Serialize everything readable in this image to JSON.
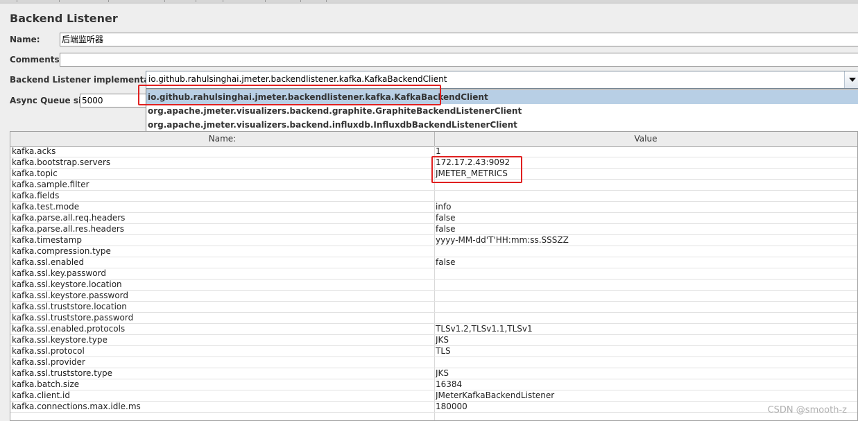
{
  "panel": {
    "title": "Backend Listener"
  },
  "form": {
    "name_label": "Name:",
    "name_value": "后端监听器",
    "comments_label": "Comments:",
    "comments_value": "",
    "impl_label": "Backend Listener implementation",
    "impl_selected": "io.github.rahulsinghai.jmeter.backendlistener.kafka.KafkaBackendClient",
    "queue_label": "Async Queue size",
    "queue_value": "5000"
  },
  "dropdown": {
    "arrow_icon": "chevron-down-icon",
    "options": [
      "io.github.rahulsinghai.jmeter.backendlistener.kafka.KafkaBackendClient",
      "org.apache.jmeter.visualizers.backend.graphite.GraphiteBackendListenerClient",
      "org.apache.jmeter.visualizers.backend.influxdb.InfluxdbBackendListenerClient"
    ],
    "selected_index": 0
  },
  "table": {
    "headers": {
      "name": "Name:",
      "value": "Value"
    },
    "rows": [
      {
        "name": "kafka.acks",
        "value": "1"
      },
      {
        "name": "kafka.bootstrap.servers",
        "value": "172.17.2.43:9092"
      },
      {
        "name": "kafka.topic",
        "value": "JMETER_METRICS"
      },
      {
        "name": "kafka.sample.filter",
        "value": ""
      },
      {
        "name": "kafka.fields",
        "value": ""
      },
      {
        "name": "kafka.test.mode",
        "value": "info"
      },
      {
        "name": "kafka.parse.all.req.headers",
        "value": "false"
      },
      {
        "name": "kafka.parse.all.res.headers",
        "value": "false"
      },
      {
        "name": "kafka.timestamp",
        "value": "yyyy-MM-dd'T'HH:mm:ss.SSSZZ"
      },
      {
        "name": "kafka.compression.type",
        "value": ""
      },
      {
        "name": "kafka.ssl.enabled",
        "value": "false"
      },
      {
        "name": "kafka.ssl.key.password",
        "value": ""
      },
      {
        "name": "kafka.ssl.keystore.location",
        "value": ""
      },
      {
        "name": "kafka.ssl.keystore.password",
        "value": ""
      },
      {
        "name": "kafka.ssl.truststore.location",
        "value": ""
      },
      {
        "name": "kafka.ssl.truststore.password",
        "value": ""
      },
      {
        "name": "kafka.ssl.enabled.protocols",
        "value": "TLSv1.2,TLSv1.1,TLSv1"
      },
      {
        "name": "kafka.ssl.keystore.type",
        "value": "JKS"
      },
      {
        "name": "kafka.ssl.protocol",
        "value": "TLS"
      },
      {
        "name": "kafka.ssl.provider",
        "value": ""
      },
      {
        "name": "kafka.ssl.truststore.type",
        "value": "JKS"
      },
      {
        "name": "kafka.batch.size",
        "value": "16384"
      },
      {
        "name": "kafka.client.id",
        "value": "JMeterKafkaBackendListener"
      },
      {
        "name": "kafka.connections.max.idle.ms",
        "value": "180000"
      }
    ]
  },
  "annotation": {
    "highlight_color": "#e02020"
  },
  "watermark": "CSDN @smooth-z"
}
